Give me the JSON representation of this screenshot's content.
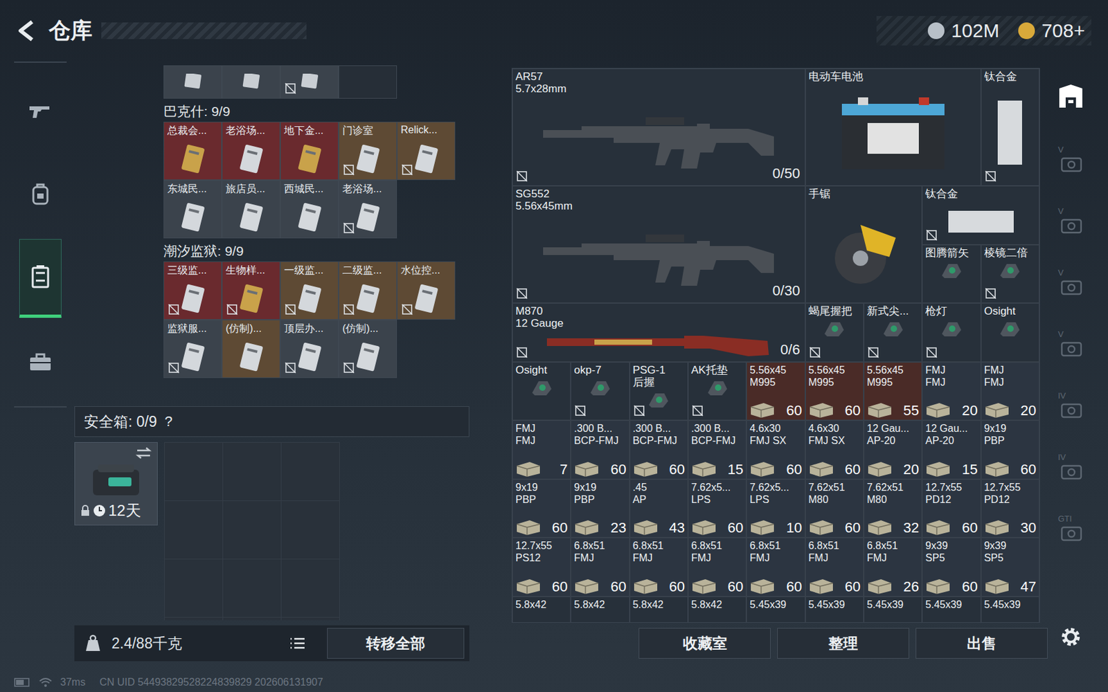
{
  "header": {
    "title": "仓库",
    "currencies": [
      {
        "amount": "102M",
        "color": "#b8c0c8"
      },
      {
        "amount": "708+",
        "color": "#d9a93a"
      }
    ]
  },
  "nav": [
    {
      "kind": "gun",
      "selected": false
    },
    {
      "kind": "backpack",
      "selected": false
    },
    {
      "kind": "container",
      "selected": true
    },
    {
      "kind": "briefcase",
      "selected": false
    }
  ],
  "keys": {
    "top_row": [
      {
        "empty": false,
        "marked": false
      },
      {
        "empty": false,
        "marked": false
      },
      {
        "empty": false,
        "marked": true
      },
      {
        "empty": true,
        "marked": false
      }
    ],
    "sections": [
      {
        "title": "巴克什: 9/9",
        "cards": [
          {
            "label": "总裁会...",
            "color": "#6a2a2e",
            "kind": "gold",
            "marked": false
          },
          {
            "label": "老浴场...",
            "color": "#6a2a2e",
            "kind": "silver",
            "marked": false
          },
          {
            "label": "地下金...",
            "color": "#6a2a2e",
            "kind": "gold",
            "marked": false
          },
          {
            "label": "门诊室",
            "color": "#5e4a34",
            "kind": "silver",
            "marked": true
          },
          {
            "label": "Relick...",
            "color": "#5e4a34",
            "kind": "silver",
            "marked": true
          },
          {
            "label": "东城民...",
            "color": "#3b434c",
            "kind": "silver",
            "marked": false
          },
          {
            "label": "旅店员...",
            "color": "#3b434c",
            "kind": "silver",
            "marked": false
          },
          {
            "label": "西城民...",
            "color": "#3b434c",
            "kind": "silver",
            "marked": false
          },
          {
            "label": "老浴场...",
            "color": "#3b434c",
            "kind": "silver",
            "marked": true
          }
        ]
      },
      {
        "title": "潮汐监狱: 9/9",
        "cards": [
          {
            "label": "三级监...",
            "color": "#6a2a2e",
            "kind": "silver",
            "marked": true
          },
          {
            "label": "生物样...",
            "color": "#6a2a2e",
            "kind": "gold",
            "marked": true
          },
          {
            "label": "一级监...",
            "color": "#5e4a34",
            "kind": "silver",
            "marked": true
          },
          {
            "label": "二级监...",
            "color": "#5e4a34",
            "kind": "silver",
            "marked": true
          },
          {
            "label": "水位控...",
            "color": "#5e4a34",
            "kind": "silver",
            "marked": true
          },
          {
            "label": "监狱服...",
            "color": "#3b434c",
            "kind": "silver",
            "marked": true
          },
          {
            "label": "(仿制)...",
            "color": "#5e4a34",
            "kind": "silver",
            "marked": false
          },
          {
            "label": "顶层办...",
            "color": "#3b434c",
            "kind": "silver",
            "marked": true
          },
          {
            "label": "(仿制)...",
            "color": "#3b434c",
            "kind": "silver",
            "marked": true
          }
        ]
      }
    ]
  },
  "safe_box": {
    "label": "安全箱: 0/9",
    "help": "?",
    "timer": "12天",
    "locked": true
  },
  "footer_left": {
    "weight": "2.4/88千克",
    "transfer": "转移全部"
  },
  "items": [
    {
      "name": "AR57",
      "sub": "5.7x28mm",
      "kind": "rifle",
      "ammo": "0/50",
      "marked": true
    },
    {
      "name": "电动车电池",
      "sub": "",
      "kind": "battery",
      "ammo": "",
      "marked": false
    },
    {
      "name": "钛合金",
      "sub": "",
      "kind": "tall",
      "ammo": "",
      "marked": true
    },
    {
      "name": "SG552",
      "sub": "5.56x45mm",
      "kind": "rifle",
      "ammo": "0/30",
      "marked": true
    },
    {
      "name": "手锯",
      "sub": "",
      "kind": "saw",
      "ammo": "",
      "marked": false
    },
    {
      "name": "钛合金",
      "sub": "",
      "kind": "wide",
      "ammo": "",
      "marked": true
    },
    {
      "name": "图腾箭矢",
      "sub": "",
      "kind": "item",
      "ammo": "",
      "marked": false
    },
    {
      "name": "棱镜二倍",
      "sub": "",
      "kind": "item",
      "ammo": "",
      "marked": true
    },
    {
      "name": "M870",
      "sub": "12 Gauge",
      "kind": "shotgun",
      "ammo": "0/6",
      "marked": true
    },
    {
      "name": "蝎尾握把",
      "sub": "",
      "kind": "item",
      "ammo": "",
      "marked": true
    },
    {
      "name": "新式尖...",
      "sub": "",
      "kind": "item",
      "ammo": "",
      "marked": true
    },
    {
      "name": "枪灯",
      "sub": "",
      "kind": "item",
      "ammo": "",
      "marked": true
    },
    {
      "name": "Osight",
      "sub": "",
      "kind": "item",
      "ammo": "",
      "marked": false
    },
    {
      "name": "Osight",
      "sub": "",
      "kind": "item",
      "ammo": "",
      "marked": false
    },
    {
      "name": "okp-7",
      "sub": "",
      "kind": "item",
      "ammo": "",
      "marked": true
    },
    {
      "name": "PSG-1",
      "sub": "后握",
      "kind": "item",
      "ammo": "",
      "marked": true
    },
    {
      "name": "AK托垫",
      "sub": "",
      "kind": "item",
      "ammo": "",
      "marked": true
    },
    {
      "name": "5.56x45",
      "sub": "M995",
      "kind": "ammo",
      "count": "60",
      "color": "#4a2b27"
    },
    {
      "name": "5.56x45",
      "sub": "M995",
      "kind": "ammo",
      "count": "60",
      "color": "#4a2b27"
    },
    {
      "name": "5.56x45",
      "sub": "M995",
      "kind": "ammo",
      "count": "55",
      "color": "#4a2b27"
    },
    {
      "name": "FMJ",
      "sub": "FMJ",
      "kind": "ammo",
      "count": "20",
      "color": "#2c3541"
    },
    {
      "name": "FMJ",
      "sub": "FMJ",
      "kind": "ammo",
      "count": "20",
      "color": "#2c3541"
    },
    {
      "name": "FMJ",
      "sub": "FMJ",
      "kind": "ammo",
      "count": "7",
      "color": "#2c3541"
    },
    {
      "name": ".300 B...",
      "sub": "BCP-FMJ",
      "kind": "ammo",
      "count": "60",
      "color": "#2c3541"
    },
    {
      "name": ".300 B...",
      "sub": "BCP-FMJ",
      "kind": "ammo",
      "count": "60",
      "color": "#2c3541"
    },
    {
      "name": ".300 B...",
      "sub": "BCP-FMJ",
      "kind": "ammo",
      "count": "15",
      "color": "#2c3541"
    },
    {
      "name": "4.6x30",
      "sub": "FMJ SX",
      "kind": "ammo",
      "count": "60",
      "color": "#2c3541"
    },
    {
      "name": "4.6x30",
      "sub": "FMJ SX",
      "kind": "ammo",
      "count": "60",
      "color": "#2c3541"
    },
    {
      "name": "12 Gau...",
      "sub": "AP-20",
      "kind": "ammo",
      "count": "20",
      "color": "#2c3541"
    },
    {
      "name": "12 Gau...",
      "sub": "AP-20",
      "kind": "ammo",
      "count": "15",
      "color": "#2c3541"
    },
    {
      "name": "9x19",
      "sub": "PBP",
      "kind": "ammo",
      "count": "60",
      "color": "#2c3541"
    },
    {
      "name": "9x19",
      "sub": "PBP",
      "kind": "ammo",
      "count": "60",
      "color": "#2c3541"
    },
    {
      "name": "9x19",
      "sub": "PBP",
      "kind": "ammo",
      "count": "23",
      "color": "#2c3541"
    },
    {
      "name": ".45",
      "sub": "AP",
      "kind": "ammo",
      "count": "43",
      "color": "#2c3541"
    },
    {
      "name": "7.62x5...",
      "sub": "LPS",
      "kind": "ammo",
      "count": "60",
      "color": "#2c3541"
    },
    {
      "name": "7.62x5...",
      "sub": "LPS",
      "kind": "ammo",
      "count": "10",
      "color": "#2c3541"
    },
    {
      "name": "7.62x51",
      "sub": "M80",
      "kind": "ammo",
      "count": "60",
      "color": "#2c3541"
    },
    {
      "name": "7.62x51",
      "sub": "M80",
      "kind": "ammo",
      "count": "32",
      "color": "#2c3541"
    },
    {
      "name": "12.7x55",
      "sub": "PD12",
      "kind": "ammo",
      "count": "60",
      "color": "#2c3541"
    },
    {
      "name": "12.7x55",
      "sub": "PD12",
      "kind": "ammo",
      "count": "30",
      "color": "#2c3541"
    },
    {
      "name": "12.7x55",
      "sub": "PS12",
      "kind": "ammo",
      "count": "60",
      "color": "#2c3541"
    },
    {
      "name": "6.8x51",
      "sub": "FMJ",
      "kind": "ammo",
      "count": "60",
      "color": "#2c3541"
    },
    {
      "name": "6.8x51",
      "sub": "FMJ",
      "kind": "ammo",
      "count": "60",
      "color": "#2c3541"
    },
    {
      "name": "6.8x51",
      "sub": "FMJ",
      "kind": "ammo",
      "count": "60",
      "color": "#2c3541"
    },
    {
      "name": "6.8x51",
      "sub": "FMJ",
      "kind": "ammo",
      "count": "60",
      "color": "#2c3541"
    },
    {
      "name": "6.8x51",
      "sub": "FMJ",
      "kind": "ammo",
      "count": "60",
      "color": "#2c3541"
    },
    {
      "name": "6.8x51",
      "sub": "FMJ",
      "kind": "ammo",
      "count": "26",
      "color": "#2c3541"
    },
    {
      "name": "9x39",
      "sub": "SP5",
      "kind": "ammo",
      "count": "60",
      "color": "#2c3541"
    },
    {
      "name": "9x39",
      "sub": "SP5",
      "kind": "ammo",
      "count": "47",
      "color": "#2c3541"
    },
    {
      "name": "5.8x42",
      "kind": "cut"
    },
    {
      "name": "5.8x42",
      "kind": "cut"
    },
    {
      "name": "5.8x42",
      "kind": "cut"
    },
    {
      "name": "5.8x42",
      "kind": "cut"
    },
    {
      "name": "5.45x39",
      "kind": "cut"
    },
    {
      "name": "5.45x39",
      "kind": "cut"
    },
    {
      "name": "5.45x39",
      "kind": "cut"
    },
    {
      "name": "5.45x39",
      "kind": "cut"
    },
    {
      "name": "5.45x39",
      "kind": "cut"
    }
  ],
  "actions": [
    "收藏室",
    "整理",
    "出售"
  ],
  "side_slots": [
    {
      "kind": "home",
      "label": ""
    },
    {
      "kind": "slot",
      "label": "V"
    },
    {
      "kind": "slot",
      "label": "V"
    },
    {
      "kind": "slot",
      "label": "V"
    },
    {
      "kind": "slot",
      "label": "V"
    },
    {
      "kind": "slot",
      "label": "IV"
    },
    {
      "kind": "slot",
      "label": "IV"
    },
    {
      "kind": "slot",
      "label": "GTI"
    }
  ],
  "status": {
    "ping": "37ms",
    "uid": "CN UID 54493829528224839829 202606131907"
  }
}
